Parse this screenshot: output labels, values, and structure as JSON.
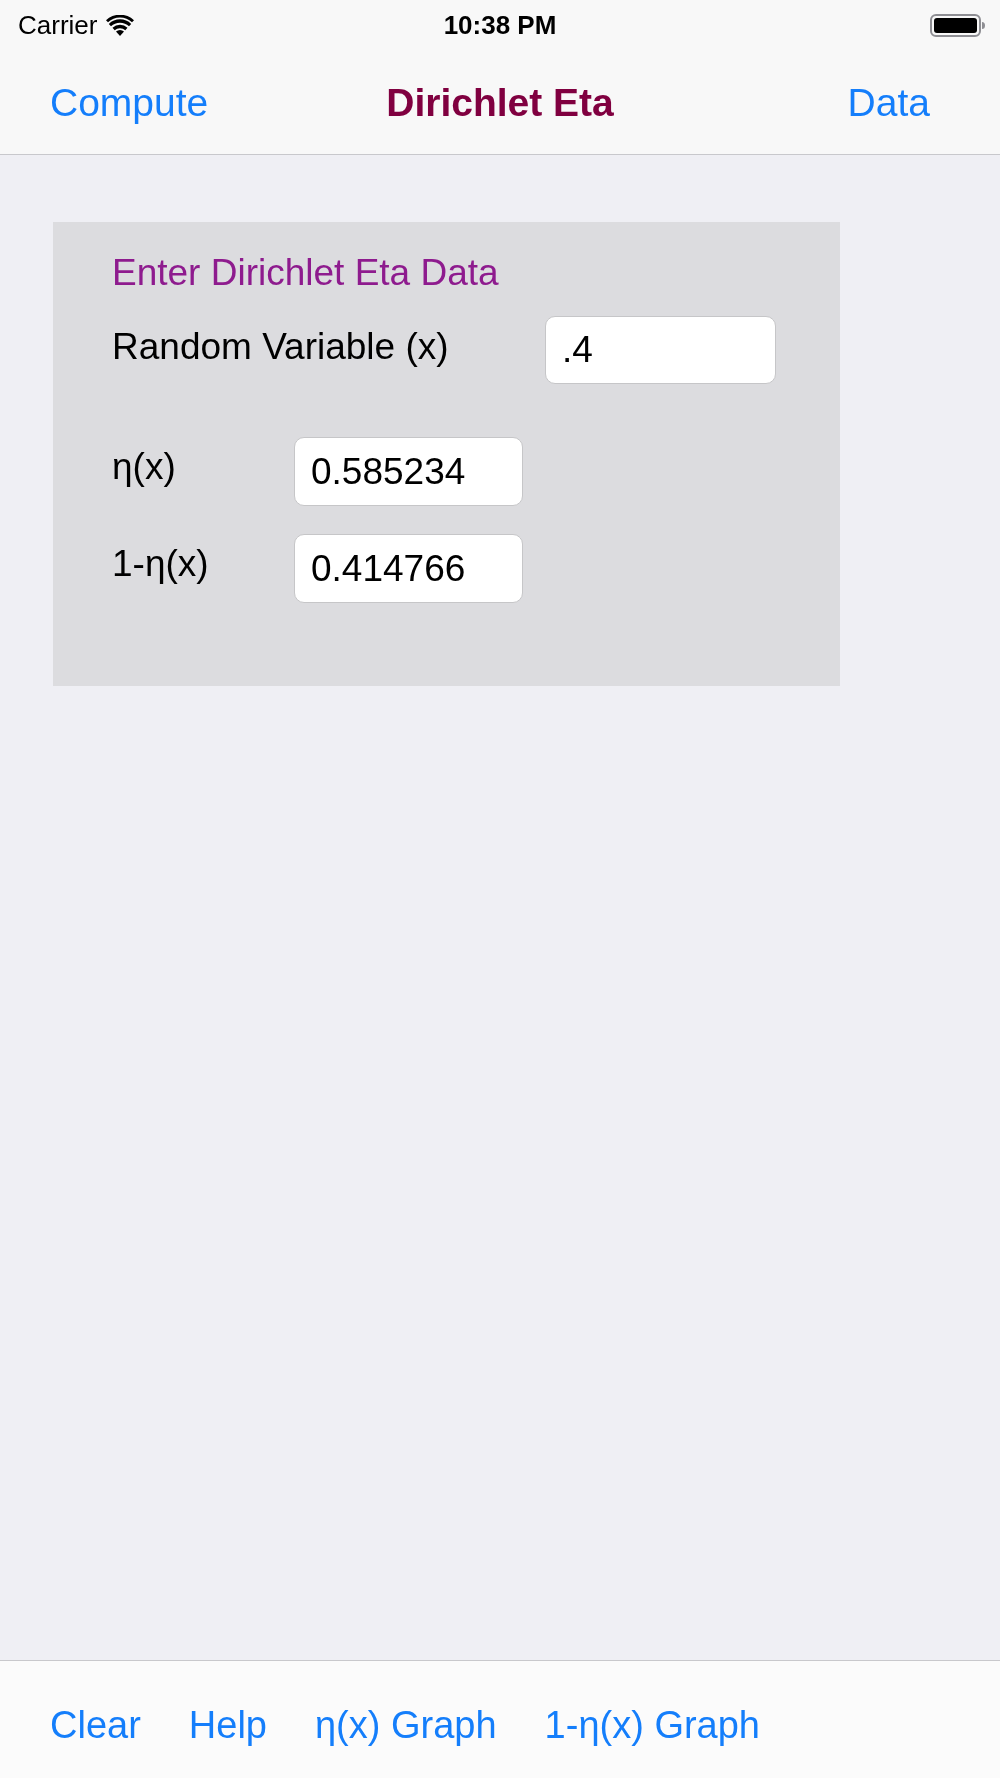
{
  "status_bar": {
    "carrier": "Carrier",
    "time": "10:38 PM"
  },
  "nav_bar": {
    "left_button": "Compute",
    "title": "Dirichlet Eta",
    "right_button": "Data"
  },
  "form": {
    "title": "Enter Dirichlet Eta Data",
    "input": {
      "label": "Random Variable (x)",
      "value": ".4"
    },
    "outputs": [
      {
        "label": "η(x)",
        "value": "0.585234"
      },
      {
        "label": "1-η(x)",
        "value": "0.414766"
      }
    ]
  },
  "toolbar": [
    "Clear",
    "Help",
    "η(x) Graph",
    "1-η(x) Graph"
  ]
}
